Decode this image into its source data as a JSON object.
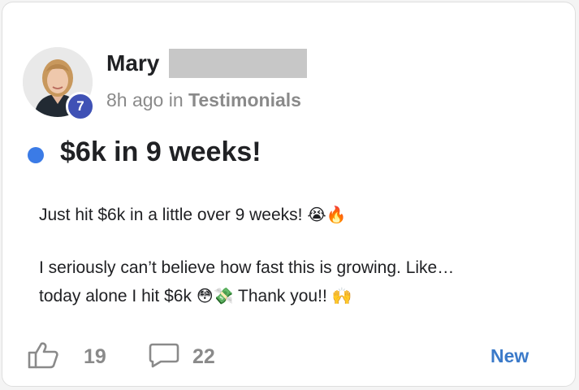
{
  "post": {
    "author": {
      "first_name": "Mary",
      "level": "7"
    },
    "time_ago": "8h ago",
    "in_word": "in",
    "category": "Testimonials",
    "title": "$6k in 9 weeks!",
    "body": {
      "line1_text": "Just hit $6k in a little over 9 weeks!",
      "line1_emoji": "😭🔥",
      "line2_text": "I seriously can’t believe how fast this is growing. Like…",
      "line3_text_a": "today alone I hit $6k",
      "line3_emoji_a": "😳💸",
      "line3_text_b": "Thank you!!",
      "line3_emoji_b": "🙌"
    },
    "likes": "19",
    "comments": "22",
    "status_label": "New"
  },
  "colors": {
    "accent": "#3b7be6",
    "badge": "#3f51b5",
    "new_label": "#3b7ac9",
    "muted_text": "#8a8a8a"
  },
  "icons": {
    "like": "thumbs-up-icon",
    "comment": "speech-bubble-icon"
  }
}
